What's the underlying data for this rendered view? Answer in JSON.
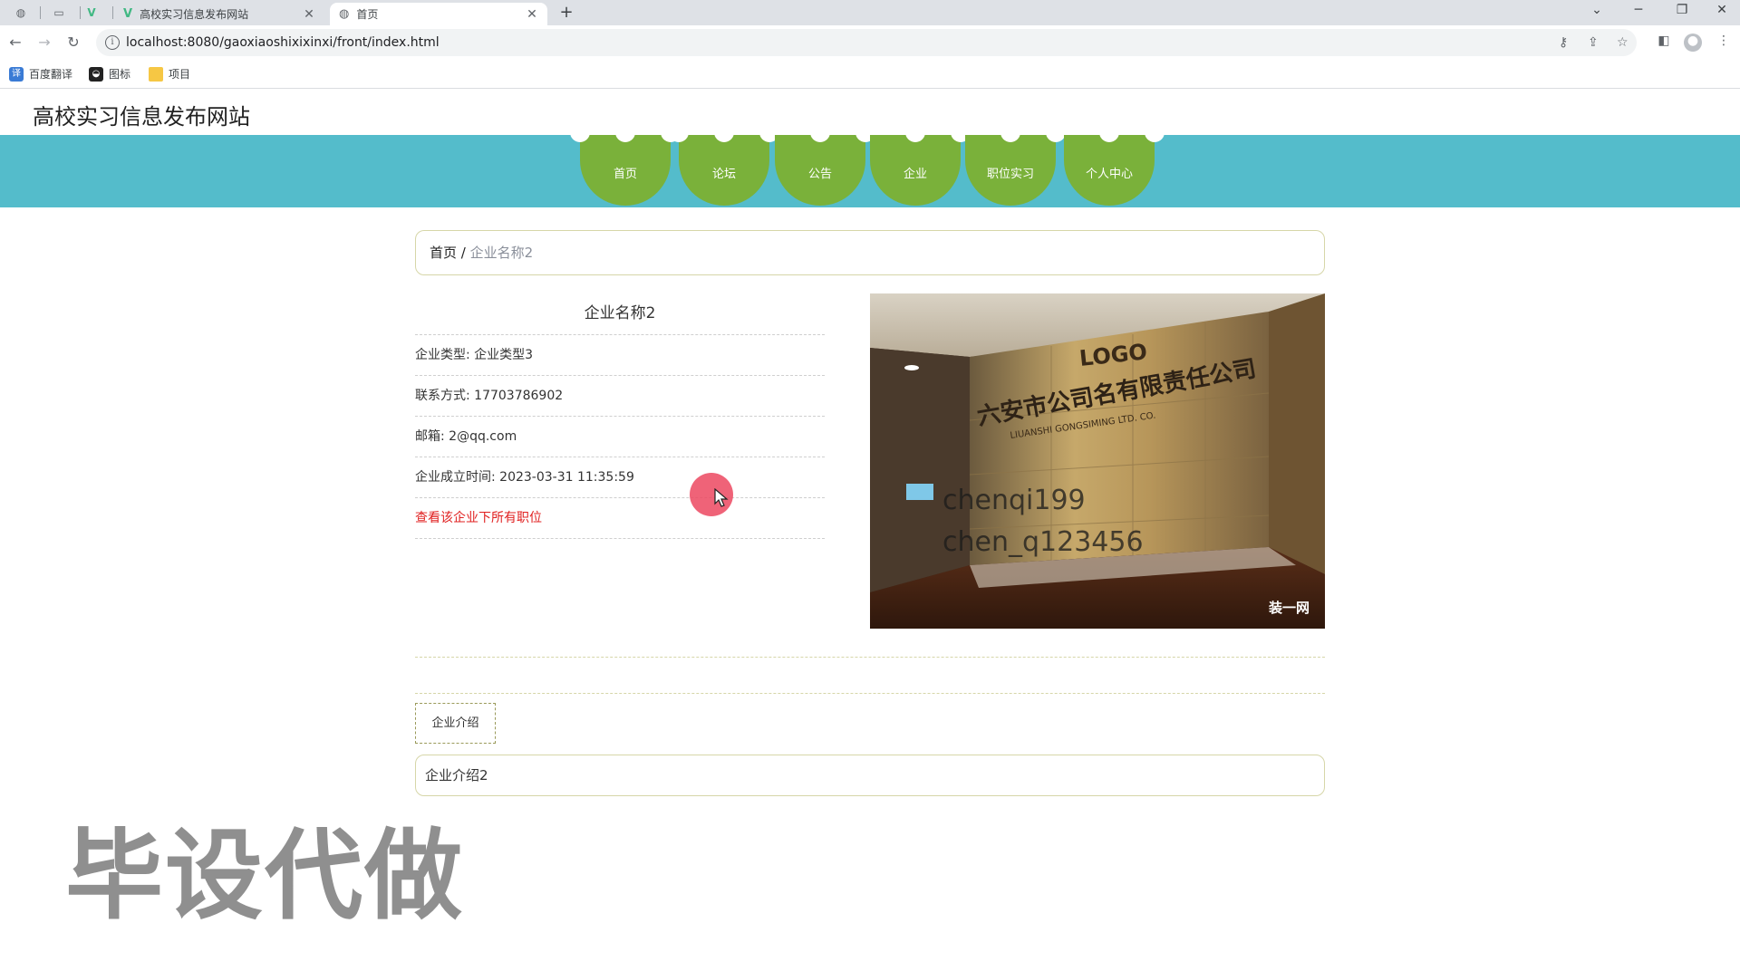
{
  "browser": {
    "tabs": [
      {
        "title": "高校实习信息发布网站",
        "active": false
      },
      {
        "title": "首页",
        "active": true
      }
    ],
    "url": "localhost:8080/gaoxiaoshixixinxi/front/index.html",
    "bookmarks": [
      "百度翻译",
      "图标",
      "项目"
    ]
  },
  "site": {
    "title": "高校实习信息发布网站",
    "nav": [
      "首页",
      "论坛",
      "公告",
      "企业",
      "职位实习",
      "个人中心"
    ]
  },
  "breadcrumb": {
    "home": "首页",
    "separator": " / ",
    "current": "企业名称2"
  },
  "company": {
    "name": "企业名称2",
    "type_label": "企业类型: ",
    "type_value": "企业类型3",
    "contact_label": "联系方式: ",
    "contact_value": "17703786902",
    "email_label": "邮箱: ",
    "email_value": "2@qq.com",
    "founded_label": "企业成立时间: ",
    "founded_value": "2023-03-31 11:35:59",
    "jobs_link": "查看该企业下所有职位"
  },
  "photo": {
    "logo_text": "LOGO",
    "company_sign": "六安市公司名有限责任公司",
    "sign_subtitle": "LIUANSHI GONGSIMING LTD. CO.",
    "overlay_line1": "chenqi199",
    "overlay_line2": "chen_q123456",
    "brand_mark": "装一网"
  },
  "intro": {
    "tab_label": "企业介绍",
    "content": "企业介绍2"
  },
  "watermark": "毕设代做",
  "colors": {
    "nav_bar": "#54bccb",
    "nav_item": "#7ab13a",
    "link_red": "#e02020"
  }
}
